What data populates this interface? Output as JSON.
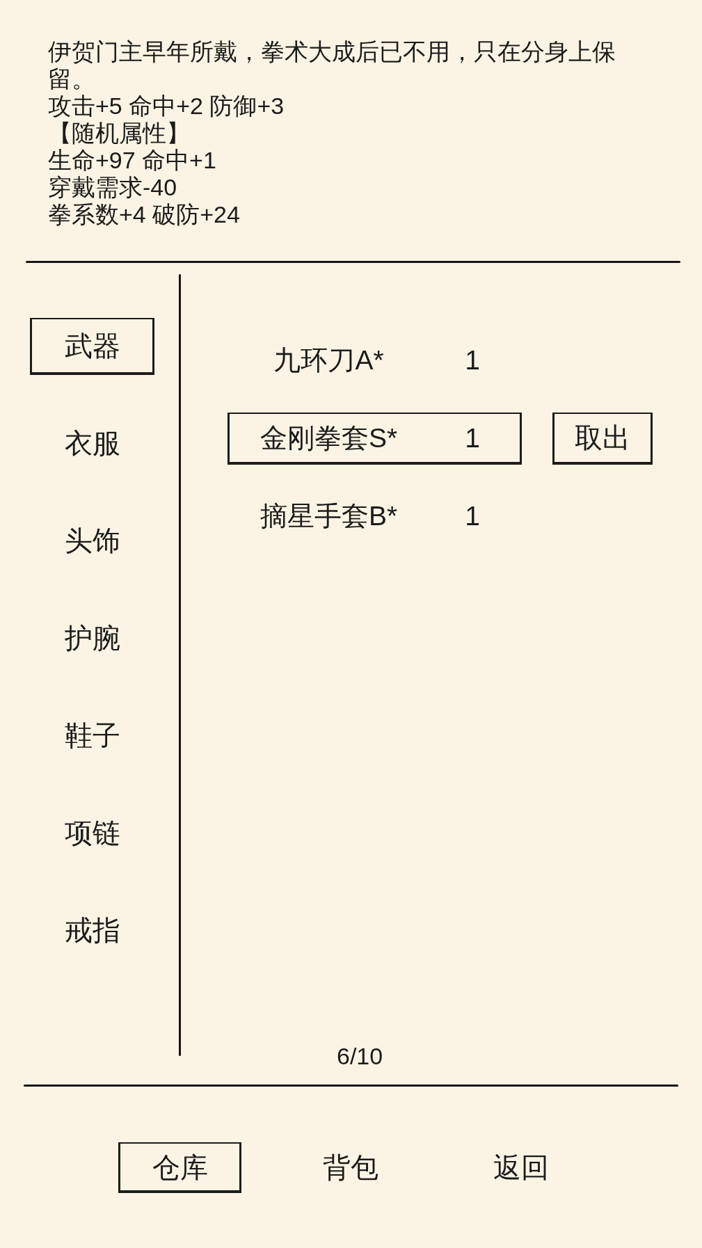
{
  "description": {
    "flavor_text": "伊贺门主早年所戴，拳术大成后已不用，只在分身上保留。",
    "base_stats": "攻击+5 命中+2 防御+3",
    "random_attributes": {
      "heading": "【随机属性】",
      "lines": [
        "生命+97 命中+1",
        "穿戴需求-40",
        "拳系数+4 破防+24"
      ]
    }
  },
  "categories": [
    {
      "label": "武器",
      "selected": true
    },
    {
      "label": "衣服",
      "selected": false
    },
    {
      "label": "头饰",
      "selected": false
    },
    {
      "label": "护腕",
      "selected": false
    },
    {
      "label": "鞋子",
      "selected": false
    },
    {
      "label": "项链",
      "selected": false
    },
    {
      "label": "戒指",
      "selected": false
    }
  ],
  "items": [
    {
      "name": "九环刀A*",
      "count": "1",
      "selected": false
    },
    {
      "name": "金刚拳套S*",
      "count": "1",
      "selected": true,
      "action": "取出"
    },
    {
      "name": "摘星手套B*",
      "count": "1",
      "selected": false
    }
  ],
  "page_indicator": "6/10",
  "bottom_tabs": [
    {
      "label": "仓库",
      "selected": true
    },
    {
      "label": "背包",
      "selected": false
    },
    {
      "label": "返回",
      "selected": false
    }
  ]
}
